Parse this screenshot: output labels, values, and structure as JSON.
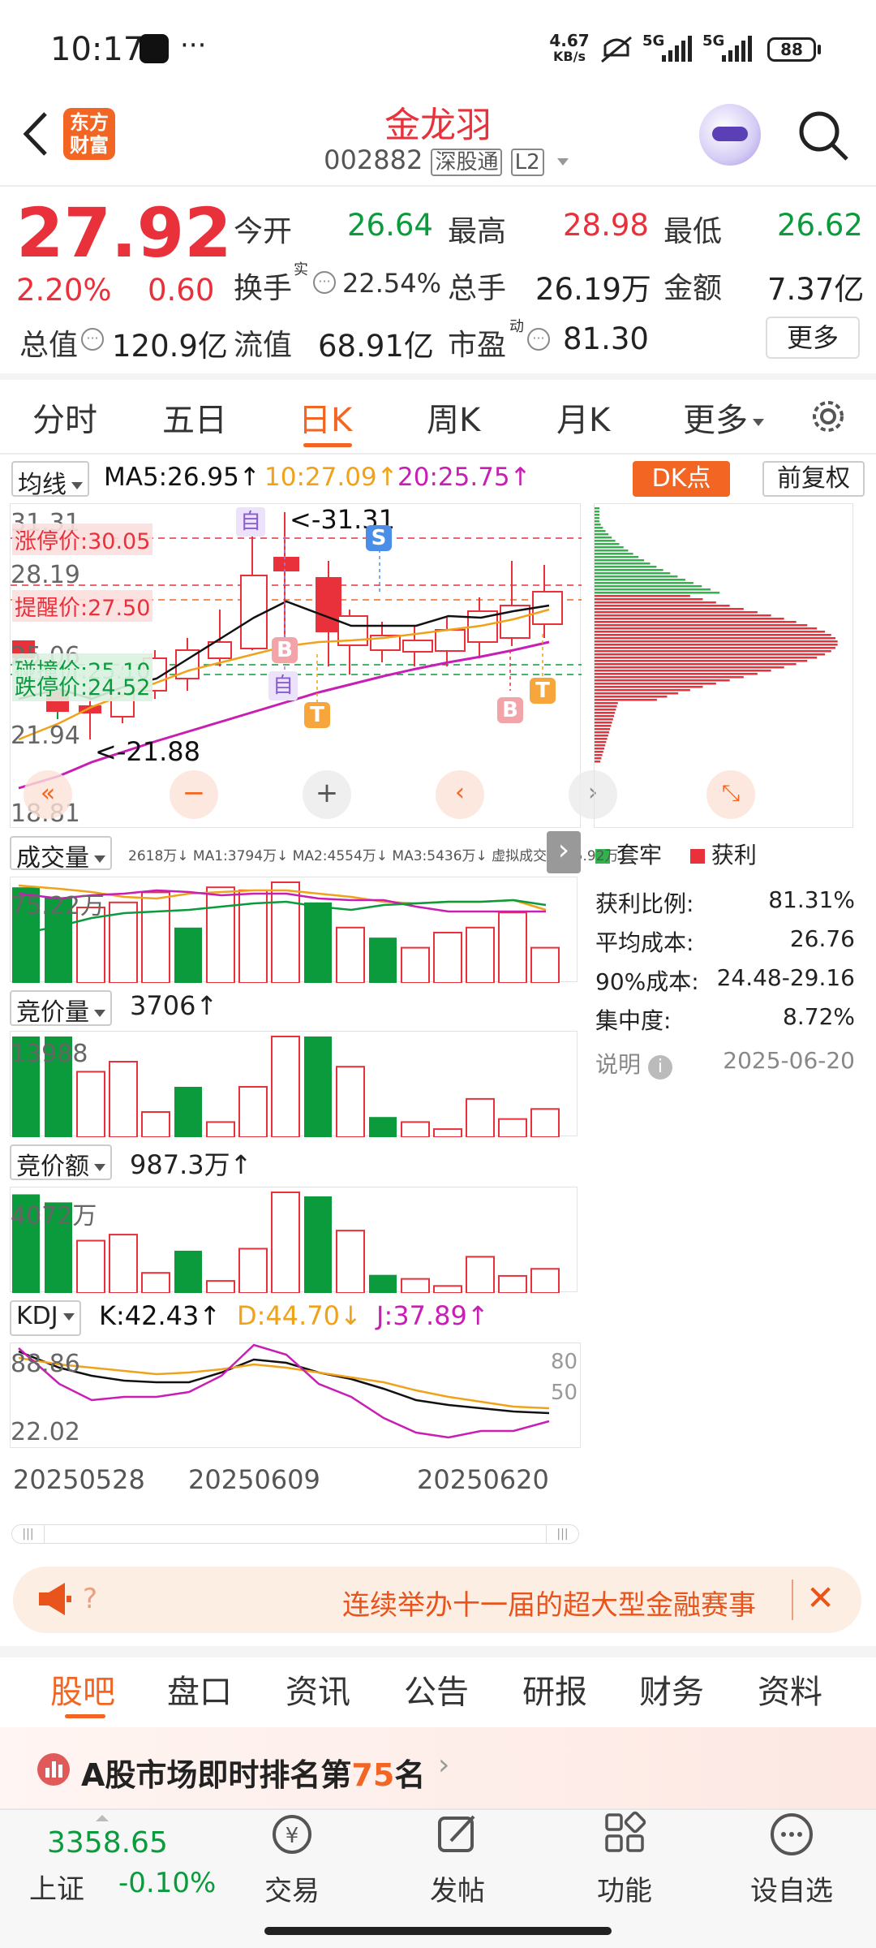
{
  "status_bar": {
    "time": "10:17",
    "net_speed_value": "4.67",
    "net_speed_unit": "KB/s",
    "signal1": "5G",
    "signal2": "5G",
    "battery": "88"
  },
  "header": {
    "title": "金龙羽",
    "code": "002882",
    "tag1": "深股通",
    "tag2": "L2",
    "logo_line1": "东方",
    "logo_line2": "财富"
  },
  "quote": {
    "price": "27.92",
    "change_pct": "2.20%",
    "change_amt": "0.60",
    "open_label": "今开",
    "open": "26.64",
    "high_label": "最高",
    "high": "28.98",
    "low_label": "最低",
    "low": "26.62",
    "turnover_label": "换手",
    "turnover_sup": "实",
    "turnover": "22.54%",
    "volume_label": "总手",
    "volume": "26.19万",
    "amount_label": "金额",
    "amount": "7.37亿",
    "mktcap_label": "总值",
    "mktcap": "120.9亿",
    "float_label": "流值",
    "float": "68.91亿",
    "pe_label": "市盈",
    "pe_sup": "动",
    "pe": "81.30",
    "more_button": "更多"
  },
  "period_tabs": [
    "分时",
    "五日",
    "日K",
    "周K",
    "月K",
    "更多"
  ],
  "active_tab": "日K",
  "ma_bar": {
    "selector": "均线",
    "ma5": "MA5:26.95",
    "ma10": "10:27.09",
    "ma20": "20:25.75",
    "dk_button": "DK点",
    "adjust_button": "前复权"
  },
  "kline": {
    "ticks": [
      "31.31",
      "28.19",
      "25.06",
      "21.94",
      "18.81"
    ],
    "limit_up": "涨停价:30.05",
    "alert": "提醒价:27.50",
    "limit_down": "跌停价:24.52",
    "touch": "碰撞价:25.10",
    "hi_marker": "<-31.31",
    "lo_marker": "<-21.88",
    "badges": [
      "自",
      "S",
      "B",
      "自",
      "T",
      "B",
      "T"
    ]
  },
  "volume_panel": {
    "selector": "成交量",
    "line": "2618万↓ MA1:3794万↓ MA2:4554万↓ MA3:5436万↓ 虚拟成交量:45.92万",
    "axis": "75.22万",
    "bars": [
      {
        "h": 0.95,
        "c": "g"
      },
      {
        "h": 0.85,
        "c": "g"
      },
      {
        "h": 0.75,
        "c": "r"
      },
      {
        "h": 0.8,
        "c": "r"
      },
      {
        "h": 0.9,
        "c": "r"
      },
      {
        "h": 0.55,
        "c": "g"
      },
      {
        "h": 0.95,
        "c": "r"
      },
      {
        "h": 0.92,
        "c": "r"
      },
      {
        "h": 1.0,
        "c": "r"
      },
      {
        "h": 0.8,
        "c": "g"
      },
      {
        "h": 0.55,
        "c": "r"
      },
      {
        "h": 0.45,
        "c": "g"
      },
      {
        "h": 0.35,
        "c": "r"
      },
      {
        "h": 0.5,
        "c": "r"
      },
      {
        "h": 0.55,
        "c": "r"
      },
      {
        "h": 0.7,
        "c": "r"
      },
      {
        "h": 0.35,
        "c": "r"
      }
    ]
  },
  "auction_vol_panel": {
    "selector": "竞价量",
    "value": "3706",
    "axis": "13988",
    "bars": [
      {
        "h": 1.0,
        "c": "g"
      },
      {
        "h": 1.0,
        "c": "g"
      },
      {
        "h": 0.65,
        "c": "r"
      },
      {
        "h": 0.75,
        "c": "r"
      },
      {
        "h": 0.25,
        "c": "r"
      },
      {
        "h": 0.5,
        "c": "g"
      },
      {
        "h": 0.15,
        "c": "r"
      },
      {
        "h": 0.5,
        "c": "r"
      },
      {
        "h": 1.0,
        "c": "r"
      },
      {
        "h": 1.0,
        "c": "g"
      },
      {
        "h": 0.7,
        "c": "r"
      },
      {
        "h": 0.2,
        "c": "g"
      },
      {
        "h": 0.15,
        "c": "r"
      },
      {
        "h": 0.08,
        "c": "r"
      },
      {
        "h": 0.38,
        "c": "r"
      },
      {
        "h": 0.18,
        "c": "r"
      },
      {
        "h": 0.28,
        "c": "r"
      }
    ]
  },
  "auction_amt_panel": {
    "selector": "竞价额",
    "value": "987.3万",
    "axis": "4072万",
    "bars": [
      {
        "h": 0.98,
        "c": "g"
      },
      {
        "h": 0.9,
        "c": "g"
      },
      {
        "h": 0.52,
        "c": "r"
      },
      {
        "h": 0.58,
        "c": "r"
      },
      {
        "h": 0.2,
        "c": "r"
      },
      {
        "h": 0.42,
        "c": "g"
      },
      {
        "h": 0.12,
        "c": "r"
      },
      {
        "h": 0.44,
        "c": "r"
      },
      {
        "h": 1.0,
        "c": "r"
      },
      {
        "h": 0.96,
        "c": "g"
      },
      {
        "h": 0.62,
        "c": "r"
      },
      {
        "h": 0.18,
        "c": "g"
      },
      {
        "h": 0.14,
        "c": "r"
      },
      {
        "h": 0.07,
        "c": "r"
      },
      {
        "h": 0.36,
        "c": "r"
      },
      {
        "h": 0.17,
        "c": "r"
      },
      {
        "h": 0.24,
        "c": "r"
      }
    ]
  },
  "kdj_panel": {
    "selector": "KDJ",
    "k": "K:42.43",
    "d": "D:44.70",
    "j": "J:37.89",
    "axis_top": "88.86",
    "axis_bottom": "22.02",
    "ref_80": "80",
    "ref_50": "50"
  },
  "date_axis": [
    "20250528",
    "20250609",
    "20250620"
  ],
  "chip_panel": {
    "legend_trapped": "套牢",
    "legend_profit": "获利",
    "rows": [
      {
        "label": "获利比例:",
        "value": "81.31%"
      },
      {
        "label": "平均成本:",
        "value": "26.76"
      },
      {
        "label": "90%成本:",
        "value": "24.48-29.16"
      },
      {
        "label": "集中度:",
        "value": "8.72%"
      }
    ],
    "note_label": "说明",
    "note_date": "2025-06-20"
  },
  "banner": {
    "left_text": "?",
    "text": "连续举办十一届的超大型金融赛事"
  },
  "bottom_tabs": [
    "股吧",
    "盘口",
    "资讯",
    "公告",
    "研报",
    "财务",
    "资料"
  ],
  "ranking": {
    "prefix": "A股市场即时排名第",
    "rank": "75",
    "suffix": "名"
  },
  "bottom_nav": {
    "index_value": "3358.65",
    "index_name": "上证",
    "index_change": "-0.10%",
    "items": [
      "交易",
      "发帖",
      "功能",
      "设自选"
    ]
  },
  "colors": {
    "up": "#e8313b",
    "down": "#0b9a3c",
    "accent": "#f26522",
    "ma5": "#111111",
    "ma10": "#f0a21a",
    "ma20": "#c81eb4"
  }
}
